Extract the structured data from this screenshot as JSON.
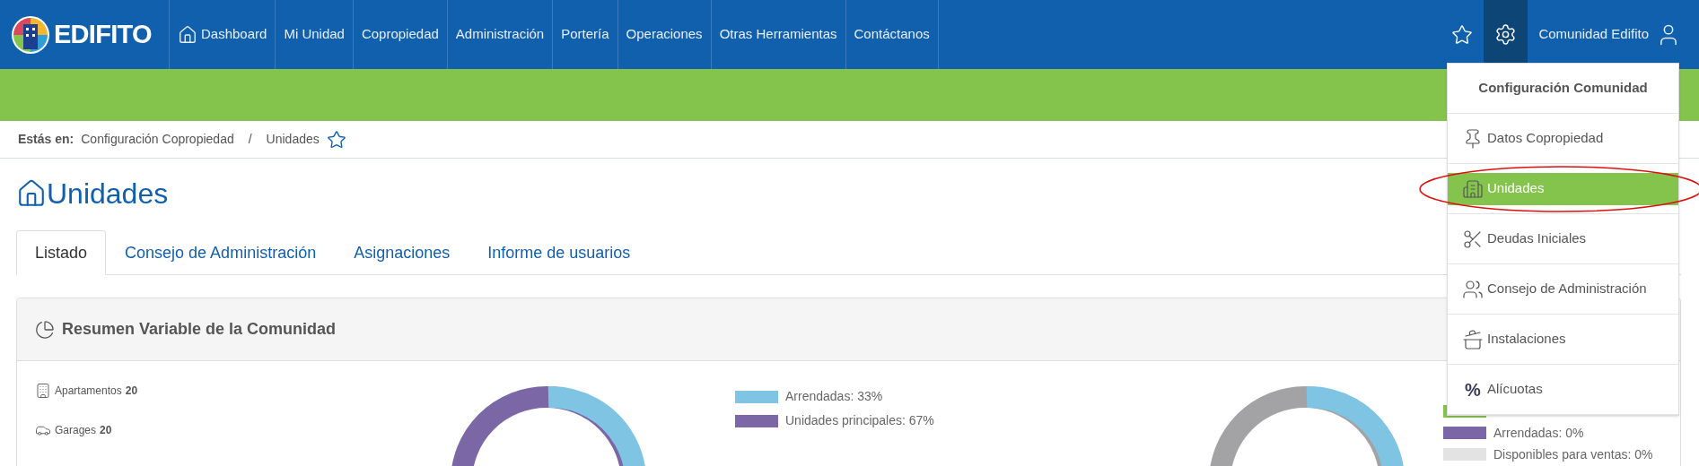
{
  "navbar": {
    "brand": "EDIFITO",
    "items": [
      {
        "label": "Dashboard",
        "selected": false
      },
      {
        "label": "Mi Unidad",
        "selected": false
      },
      {
        "label": "Copropiedad",
        "selected": false
      },
      {
        "label": "Administración",
        "selected": false
      },
      {
        "label": "Portería",
        "selected": false
      },
      {
        "label": "Operaciones",
        "selected": false
      },
      {
        "label": "Otras Herramientas",
        "selected": false
      },
      {
        "label": "Contáctanos",
        "selected": false
      }
    ],
    "user": "Comunidad Edifito",
    "settings_open": true
  },
  "breadcrumb": {
    "prefix": "Estás en:",
    "items": [
      "Configuración Copropiedad",
      "Unidades"
    ],
    "separator": "/"
  },
  "page_title": "Unidades",
  "tabs": [
    {
      "label": "Listado",
      "selected": true
    },
    {
      "label": "Consejo de Administración",
      "selected": false
    },
    {
      "label": "Asignaciones",
      "selected": false
    },
    {
      "label": "Informe de usuarios",
      "selected": false
    }
  ],
  "summary": {
    "title": "Resumen Variable de la Comunidad",
    "counts": [
      {
        "label": "Apartamentos",
        "value": "20"
      },
      {
        "label": "Garages",
        "value": "20"
      }
    ],
    "legend_1": [
      {
        "label": "Arrendadas: 33%",
        "color": "#7fc4e2"
      },
      {
        "label": "Unidades principales: 67%",
        "color": "#7b67a6"
      }
    ],
    "legend_2": [
      {
        "color": "#84c44c"
      },
      {
        "label": "Arrendadas: 0%",
        "color": "#7b67a6"
      },
      {
        "label": "Disponibles para ventas: 0%",
        "color": "#e3e3e3"
      }
    ]
  },
  "settings_menu": {
    "title": "Configuración Comunidad",
    "items": [
      {
        "label": "Datos Copropiedad",
        "selected": false
      },
      {
        "label": "Unidades",
        "selected": true,
        "circled": true
      },
      {
        "label": "Deudas Iniciales",
        "selected": false
      },
      {
        "label": "Consejo de Administración",
        "selected": false
      },
      {
        "label": "Instalaciones",
        "selected": false
      },
      {
        "label": "Alícuotas",
        "selected": false,
        "symbol": "%"
      }
    ]
  }
}
